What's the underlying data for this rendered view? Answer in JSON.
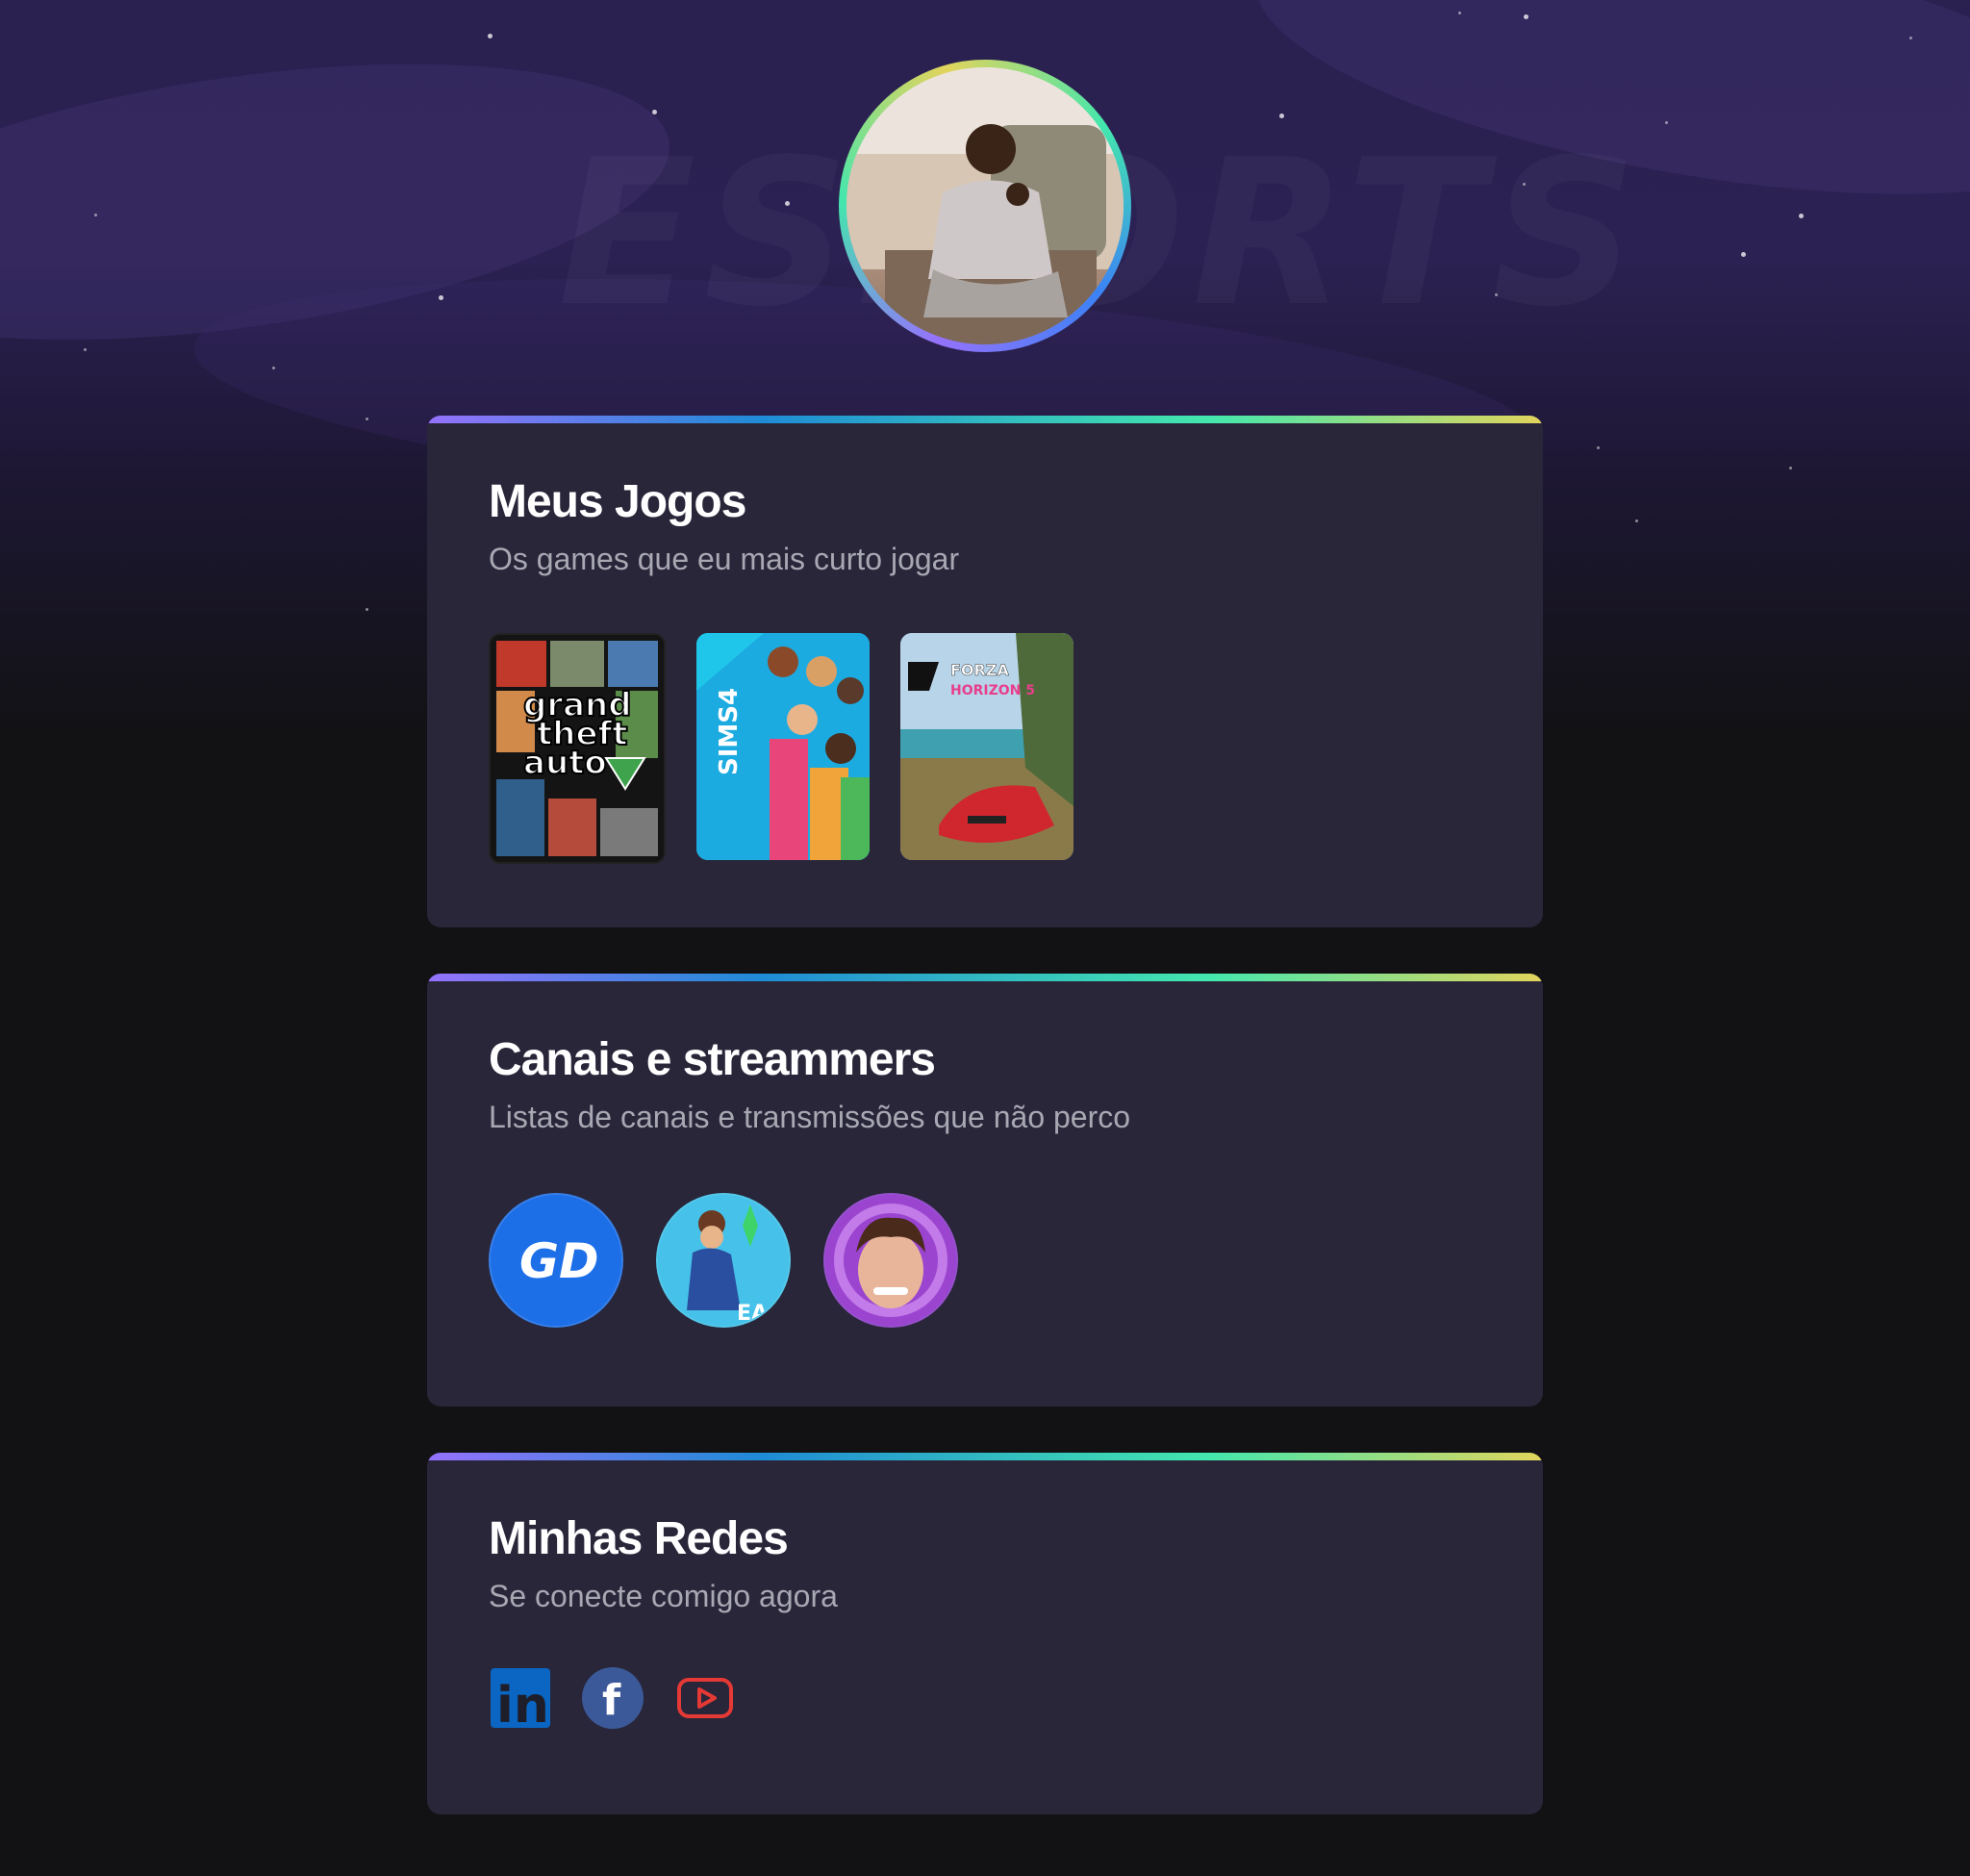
{
  "profile": {
    "avatar_alt": ""
  },
  "sections": {
    "games": {
      "title": "Meus Jogos",
      "subtitle": "Os games que eu mais curto jogar"
    },
    "channels": {
      "title": "Canais e streammers",
      "subtitle": "Listas de canais e transmissões que não perco"
    },
    "socials": {
      "title": "Minhas Redes",
      "subtitle": "Se conecte comigo agora"
    }
  },
  "games": [
    {
      "name": "grand theft auto five",
      "line1": "grand",
      "line2": "theft",
      "line3": "auto"
    },
    {
      "name": "The Sims 4",
      "label": "SIMS4"
    },
    {
      "name": "Forza Horizon 5",
      "line1": "FORZA",
      "line2": "HORIZON 5"
    }
  ],
  "channels": [
    {
      "name": "GD",
      "label": "GD"
    },
    {
      "name": "The Sims",
      "label": "EA"
    },
    {
      "name": "streamer"
    }
  ],
  "socials": [
    {
      "name": "linkedin-icon",
      "label": "in"
    },
    {
      "name": "facebook-icon",
      "label": "f"
    },
    {
      "name": "youtube-icon"
    }
  ],
  "colors": {
    "card": "#29263a",
    "gradient": [
      "#9572fc",
      "#43e7ad",
      "#e2d45c"
    ],
    "linkedin": "#0a66c2",
    "facebook": "#3b5998",
    "youtube": "#e53935"
  }
}
